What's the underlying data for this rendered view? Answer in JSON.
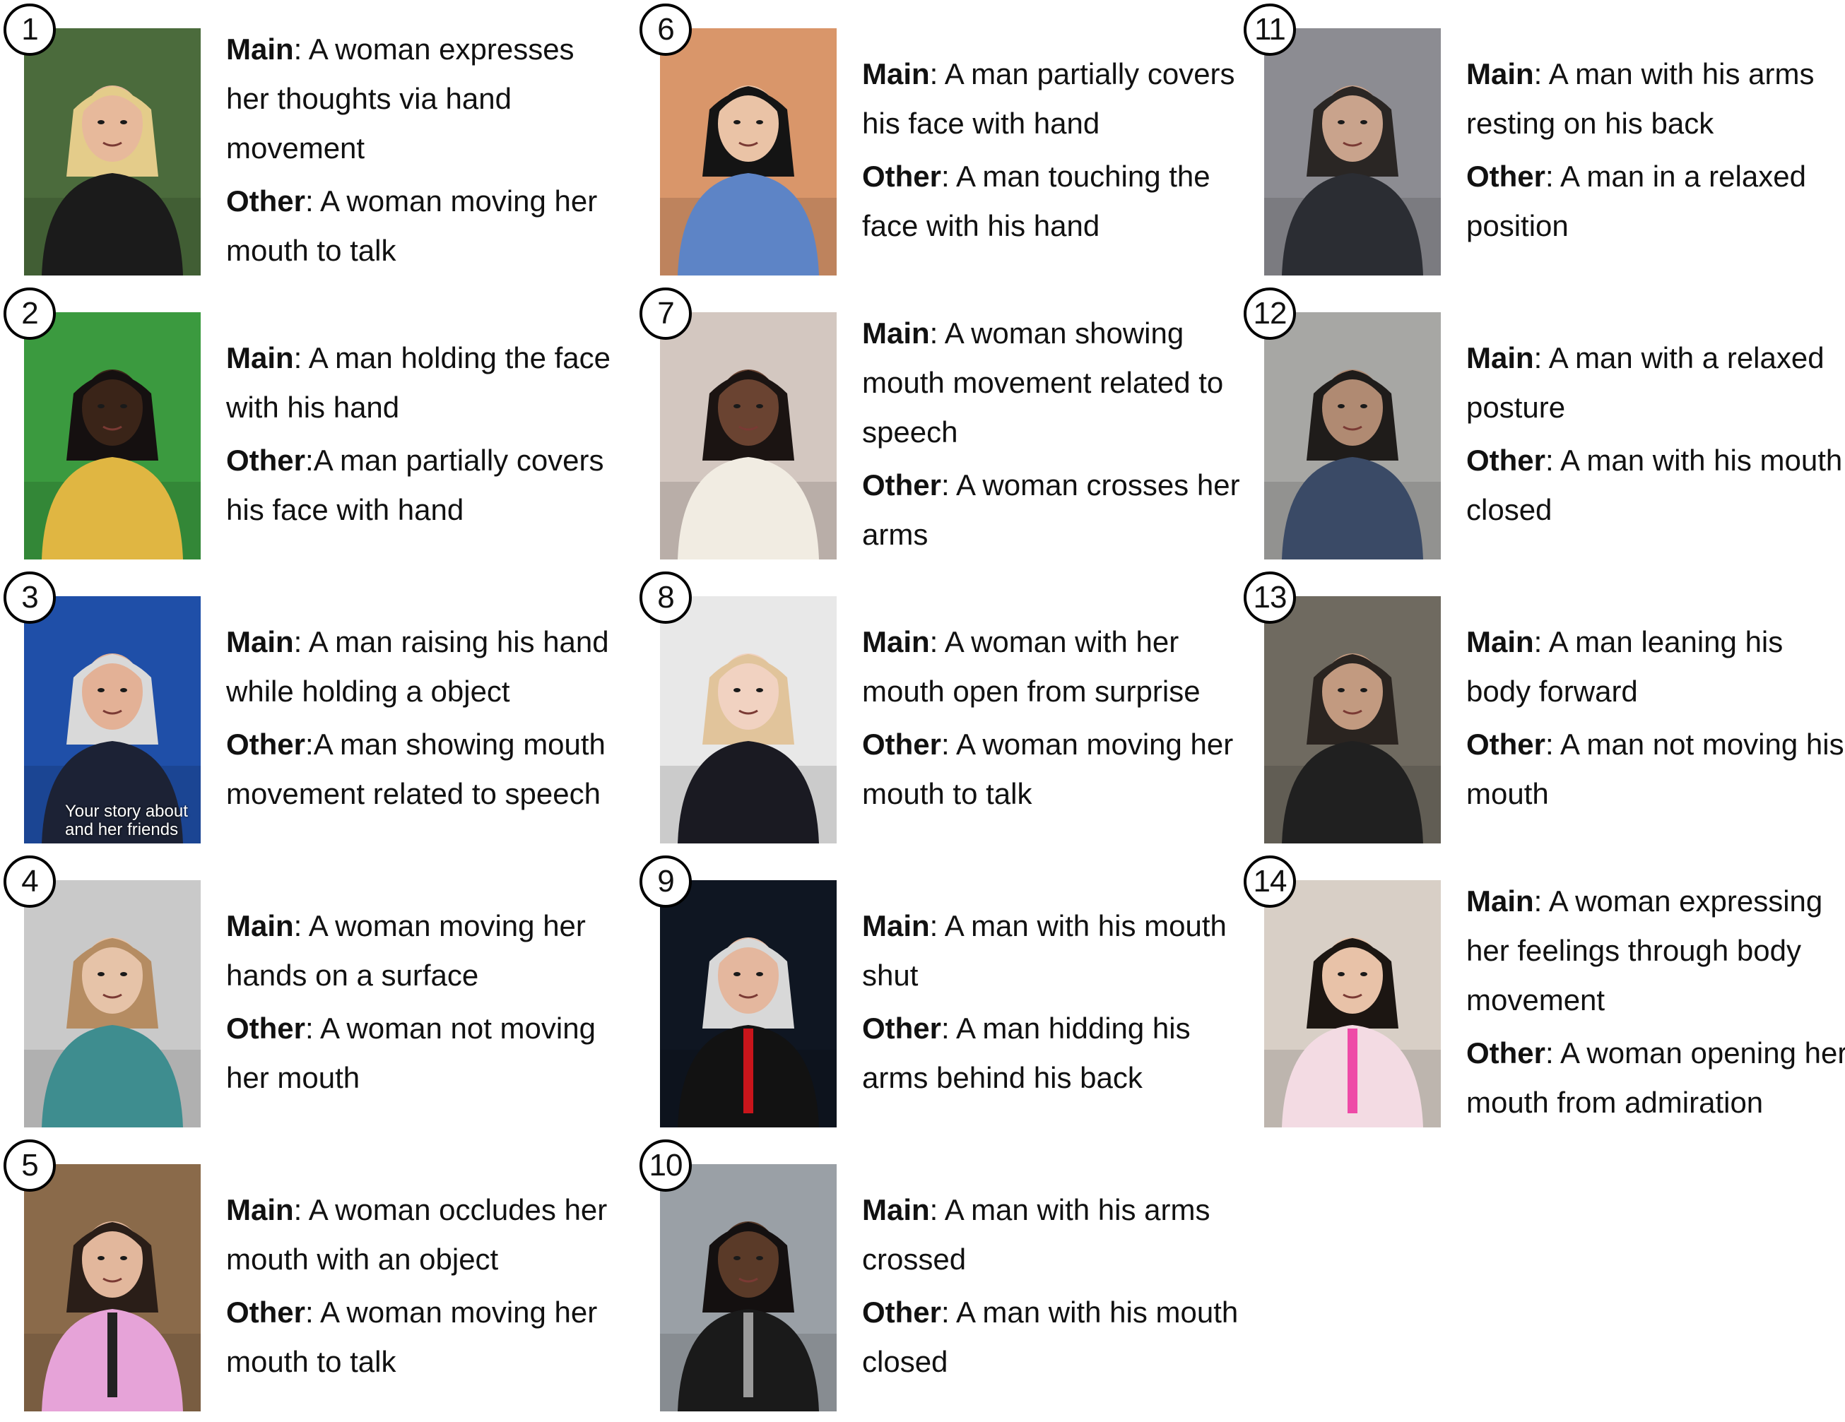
{
  "figure": {
    "panels": [
      {
        "num": "1",
        "main_label": "Main",
        "main_sep": ": ",
        "main": "A woman expresses her thoughts via hand movement",
        "other_label": "Other",
        "other_sep": ": ",
        "other": "A woman moving her mouth to talk",
        "thumb": {
          "bg": "#4b6b3c",
          "skin": "#e7b99b",
          "hair": "#e4cc8a",
          "cloth": "#1b1b1b",
          "prop": ""
        }
      },
      {
        "num": "2",
        "main_label": "Main",
        "main_sep": ": ",
        "main": "A man holding the face with his hand",
        "other_label": "Other",
        "other_sep": ":",
        "other": "A man partially covers his face with hand",
        "thumb": {
          "bg": "#3b9a3f",
          "skin": "#3a2418",
          "hair": "#151010",
          "cloth": "#e0b642",
          "prop": ""
        }
      },
      {
        "num": "3",
        "main_label": "Main",
        "main_sep": ": ",
        "main": "A man raising his hand while holding a object",
        "other_label": "Other",
        "other_sep": ":",
        "other": "A man showing mouth movement related to speech",
        "overlay": "Your story about and her friends",
        "thumb": {
          "bg": "#1f4fa8",
          "skin": "#e3b196",
          "hair": "#d9d9d9",
          "cloth": "#1c2235",
          "prop": ""
        }
      },
      {
        "num": "4",
        "main_label": "Main",
        "main_sep": ": ",
        "main": "A woman moving her hands on a surface",
        "other_label": "Other",
        "other_sep": ": ",
        "other": "A woman not moving her mouth",
        "thumb": {
          "bg": "#c9c9c9",
          "skin": "#e6c3a8",
          "hair": "#b58c62",
          "cloth": "#3e8d8f",
          "prop": ""
        }
      },
      {
        "num": "5",
        "main_label": "Main",
        "main_sep": ": ",
        "main": "A woman occludes her mouth with an object",
        "other_label": "Other",
        "other_sep": ": ",
        "other": "A woman moving her mouth to talk",
        "thumb": {
          "bg": "#8a6a4a",
          "skin": "#e2b79c",
          "hair": "#2a1e18",
          "cloth": "#e6a3d8",
          "prop": "#222"
        }
      },
      {
        "num": "6",
        "main_label": "Main",
        "main_sep": ": ",
        "main": "A man partially covers his face with hand",
        "other_label": "Other",
        "other_sep": ": ",
        "other": "A man touching the face with his hand",
        "thumb": {
          "bg": "#d9966a",
          "skin": "#eac3a6",
          "hair": "#141414",
          "cloth": "#5d84c6",
          "prop": ""
        }
      },
      {
        "num": "7",
        "main_label": "Main",
        "main_sep": ": ",
        "main": "A woman showing mouth movement related to speech",
        "other_label": "Other",
        "other_sep": ": ",
        "other": "A woman crosses her arms",
        "thumb": {
          "bg": "#d3c7c0",
          "skin": "#6a4331",
          "hair": "#1b1412",
          "cloth": "#f1ece2",
          "prop": ""
        }
      },
      {
        "num": "8",
        "main_label": "Main",
        "main_sep": ": ",
        "main": "A woman with her mouth open from surprise",
        "other_label": "Other",
        "other_sep": ": ",
        "other": "A woman moving her mouth to talk",
        "thumb": {
          "bg": "#e8e8e8",
          "skin": "#f1d2c1",
          "hair": "#e1c49b",
          "cloth": "#1a1a22",
          "prop": ""
        }
      },
      {
        "num": "9",
        "main_label": "Main",
        "main_sep": ": ",
        "main": "A man with his mouth shut",
        "other_label": "Other",
        "other_sep": ": ",
        "other": "A man hidding his arms behind his back",
        "thumb": {
          "bg": "#0f1622",
          "skin": "#e4b79e",
          "hair": "#d8d8d8",
          "cloth": "#121212",
          "prop": "#c8151b"
        }
      },
      {
        "num": "10",
        "main_label": "Main",
        "main_sep": ": ",
        "main": "A man with his arms crossed",
        "other_label": "Other",
        "other_sep": ": ",
        "other": "A man with his mouth closed",
        "thumb": {
          "bg": "#9aa0a6",
          "skin": "#5a3a28",
          "hair": "#141010",
          "cloth": "#1a1a1a",
          "prop": "#9a9a9a"
        }
      },
      {
        "num": "11",
        "main_label": "Main",
        "main_sep": ": ",
        "main": "A man with his arms resting on his back",
        "other_label": "Other",
        "other_sep": ": ",
        "other": "A man in a relaxed position",
        "thumb": {
          "bg": "#8c8c92",
          "skin": "#c9a38c",
          "hair": "#2a2624",
          "cloth": "#2b2d33",
          "prop": ""
        }
      },
      {
        "num": "12",
        "main_label": "Main",
        "main_sep": ": ",
        "main": "A man with a relaxed posture",
        "other_label": "Other",
        "other_sep": ": ",
        "other": "A man with his mouth closed",
        "thumb": {
          "bg": "#a7a7a4",
          "skin": "#b08a72",
          "hair": "#1f1c1a",
          "cloth": "#3a4a66",
          "prop": ""
        }
      },
      {
        "num": "13",
        "main_label": "Main",
        "main_sep": ": ",
        "main": "A man leaning his body forward",
        "other_label": "Other",
        "other_sep": ": ",
        "other": "A man not moving his mouth",
        "thumb": {
          "bg": "#6f6a60",
          "skin": "#c29a80",
          "hair": "#2a2420",
          "cloth": "#202020",
          "prop": ""
        }
      },
      {
        "num": "14",
        "main_label": "Main",
        "main_sep": ": ",
        "main": "A woman expressing her feelings through body movement",
        "other_label": "Other",
        "other_sep": ": ",
        "other": "A woman opening her mouth from admiration",
        "thumb": {
          "bg": "#d8cfc6",
          "skin": "#e8c2a8",
          "hair": "#1c1612",
          "cloth": "#f3dbe3",
          "prop": "#ee4aa7"
        }
      }
    ]
  }
}
